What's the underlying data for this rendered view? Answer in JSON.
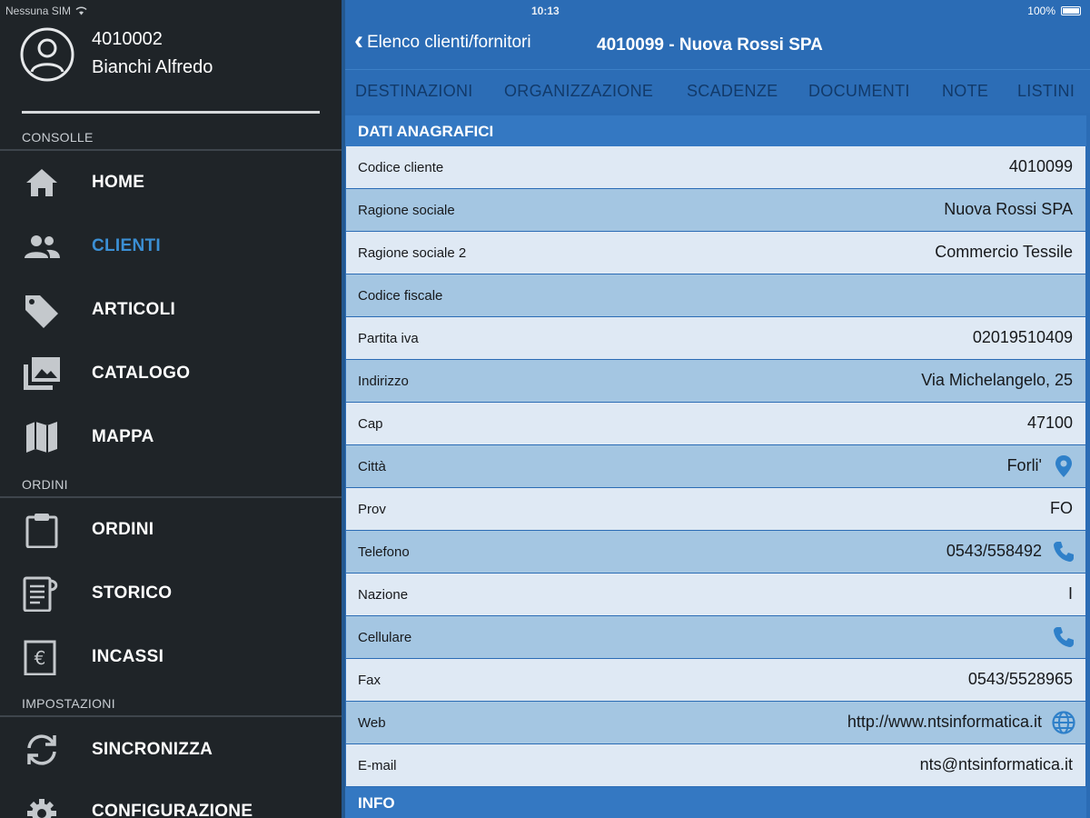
{
  "status_bar": {
    "carrier": "Nessuna SIM",
    "time": "10:13",
    "battery": "100%"
  },
  "sidebar": {
    "profile": {
      "code": "4010002",
      "name": "Bianchi Alfredo"
    },
    "sections": [
      {
        "title": "CONSOLLE",
        "items": [
          {
            "label": "HOME",
            "icon": "home-icon"
          },
          {
            "label": "CLIENTI",
            "icon": "people-icon",
            "active": true
          },
          {
            "label": "ARTICOLI",
            "icon": "tag-icon"
          },
          {
            "label": "CATALOGO",
            "icon": "images-icon"
          },
          {
            "label": "MAPPA",
            "icon": "map-icon"
          }
        ]
      },
      {
        "title": "ORDINI",
        "items": [
          {
            "label": "ORDINI",
            "icon": "clipboard-icon"
          },
          {
            "label": "STORICO",
            "icon": "receipt-icon"
          },
          {
            "label": "INCASSI",
            "icon": "euro-receipt-icon"
          }
        ]
      },
      {
        "title": "IMPOSTAZIONI",
        "items": [
          {
            "label": "SINCRONIZZA",
            "icon": "sync-icon"
          },
          {
            "label": "CONFIGURAZIONE",
            "icon": "gear-icon"
          }
        ]
      }
    ]
  },
  "navbar": {
    "back_label": "Elenco clienti/fornitori",
    "title": "4010099 - Nuova Rossi SPA"
  },
  "tabs": [
    "DESTINAZIONI",
    "ORGANIZZAZIONE",
    "SCADENZE",
    "DOCUMENTI",
    "NOTE",
    "LISTINI"
  ],
  "section_title": "DATI ANAGRAFICI",
  "fields": [
    {
      "label": "Codice cliente",
      "value": "4010099"
    },
    {
      "label": "Ragione sociale",
      "value": "Nuova Rossi SPA"
    },
    {
      "label": "Ragione sociale 2",
      "value": "Commercio Tessile"
    },
    {
      "label": "Codice fiscale",
      "value": ""
    },
    {
      "label": "Partita iva",
      "value": "02019510409"
    },
    {
      "label": "Indirizzo",
      "value": "Via Michelangelo, 25"
    },
    {
      "label": "Cap",
      "value": "47100"
    },
    {
      "label": "Città",
      "value": "Forli'",
      "icon": "map-pin-icon"
    },
    {
      "label": "Prov",
      "value": "FO"
    },
    {
      "label": "Telefono",
      "value": "0543/558492",
      "icon": "phone-icon"
    },
    {
      "label": "Nazione",
      "value": "I"
    },
    {
      "label": "Cellulare",
      "value": "",
      "icon": "phone-icon"
    },
    {
      "label": "Fax",
      "value": "0543/5528965"
    },
    {
      "label": "Web",
      "value": "http://www.ntsinformatica.it",
      "icon": "globe-icon"
    },
    {
      "label": "E-mail",
      "value": "nts@ntsinformatica.it"
    }
  ],
  "info_title": "INFO",
  "colors": {
    "sidebar_bg": "#1f2428",
    "accent": "#3b8fd4",
    "header_blue": "#2b6cb5",
    "row_light": "#dfe9f4",
    "row_dark": "#a4c6e2"
  }
}
